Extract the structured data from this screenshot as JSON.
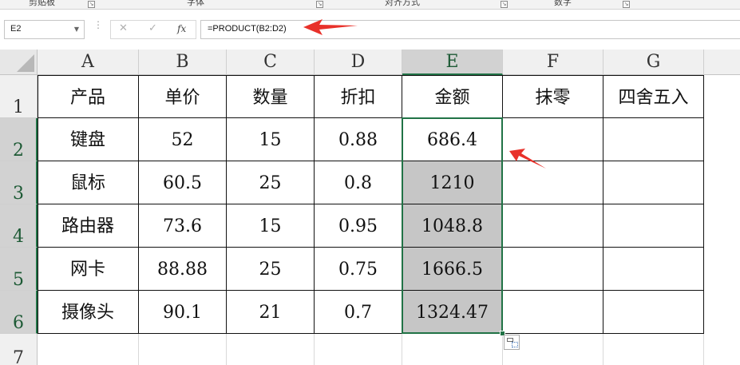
{
  "ribbon": {
    "groups": [
      {
        "label": "剪贴板"
      },
      {
        "label": "字体"
      },
      {
        "label": "对齐方式"
      },
      {
        "label": "数字"
      }
    ]
  },
  "formula_bar": {
    "name_box": "E2",
    "formula": "=PRODUCT(B2:D2)",
    "cancel_icon": "✕",
    "enter_icon": "✓",
    "function_icon": "fx"
  },
  "sheet": {
    "columns": [
      "A",
      "B",
      "C",
      "D",
      "E",
      "F",
      "G"
    ],
    "active_column": "E",
    "rows": [
      "1",
      "2",
      "3",
      "4",
      "5",
      "6",
      "7"
    ],
    "active_rows": [
      "2",
      "3",
      "4",
      "5",
      "6"
    ],
    "header_row": [
      "产品",
      "单价",
      "数量",
      "折扣",
      "金额",
      "抹零",
      "四舍五入"
    ],
    "data_rows": [
      [
        "键盘",
        "52",
        "15",
        "0.88",
        "686.4",
        "",
        ""
      ],
      [
        "鼠标",
        "60.5",
        "25",
        "0.8",
        "1210",
        "",
        ""
      ],
      [
        "路由器",
        "73.6",
        "15",
        "0.95",
        "1048.8",
        "",
        ""
      ],
      [
        "网卡",
        "88.88",
        "25",
        "0.75",
        "1666.5",
        "",
        ""
      ],
      [
        "摄像头",
        "90.1",
        "21",
        "0.7",
        "1324.47",
        "",
        ""
      ]
    ],
    "active_cell": "E2",
    "selected_range": "E2:E6"
  },
  "colors": {
    "selection_border": "#217346",
    "selection_fill": "#c6c6c6",
    "annotation_arrow": "#e8312a"
  }
}
